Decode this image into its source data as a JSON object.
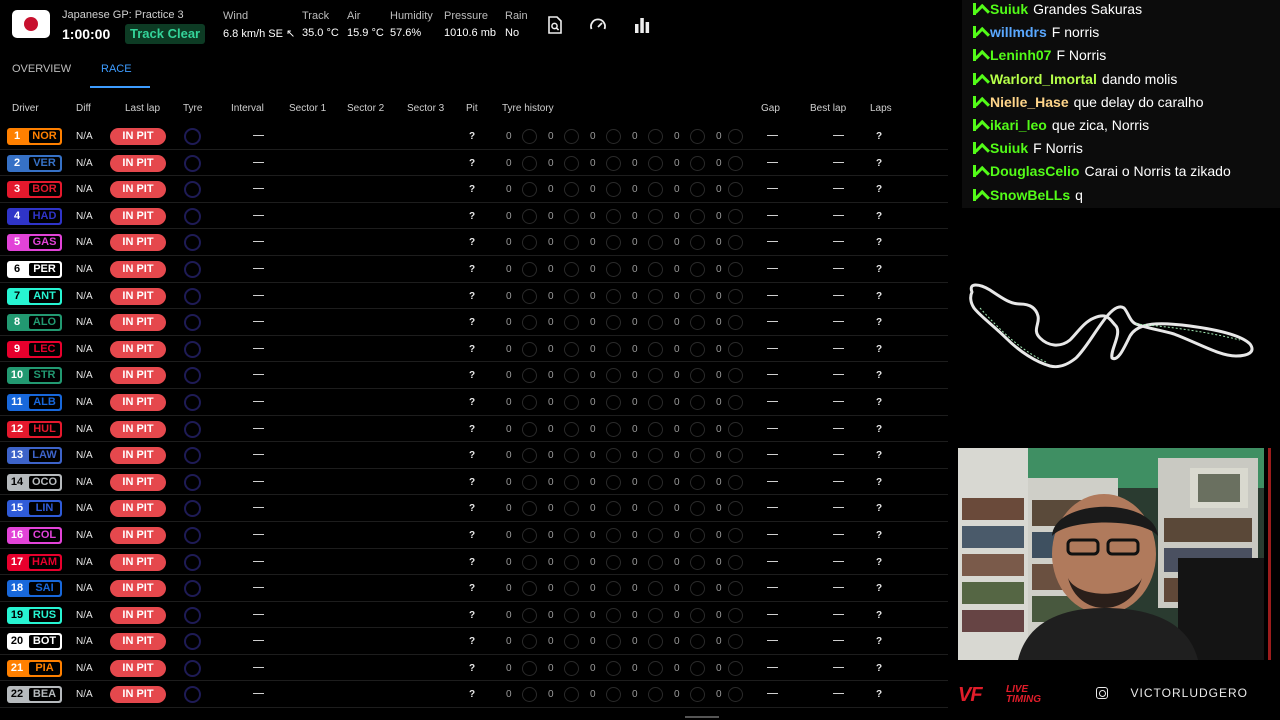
{
  "header": {
    "session_name": "Japanese GP: Practice 3",
    "session_clock": "1:00:00",
    "track_status": "Track Clear",
    "weather": [
      {
        "label": "Wind",
        "value": "6.8 km/h SE ↖"
      },
      {
        "label": "Track",
        "value": "35.0 °C"
      },
      {
        "label": "Air",
        "value": "15.9 °C"
      },
      {
        "label": "Humidity",
        "value": "57.6%"
      },
      {
        "label": "Pressure",
        "value": "1010.6 mb"
      },
      {
        "label": "Rain",
        "value": "No"
      }
    ],
    "icons": [
      "document-search-icon",
      "speedometer-icon",
      "bar-chart-icon"
    ],
    "flag": "japan-flag"
  },
  "tabs": [
    {
      "label": "OVERVIEW",
      "active": false
    },
    {
      "label": "RACE",
      "active": true
    }
  ],
  "columns": [
    "Driver",
    "Diff",
    "Last lap",
    "Tyre",
    "Interval",
    "Sector 1",
    "Sector 2",
    "Sector 3",
    "Pit",
    "Tyre history",
    "Gap",
    "Best lap",
    "Laps"
  ],
  "row_defaults": {
    "diff": "N/A",
    "status": "IN PIT",
    "dash": "—",
    "pit": "?",
    "history_zero": "0",
    "laps": "?"
  },
  "drivers": [
    {
      "pos": "1",
      "code": "NOR",
      "color": "#ff8000"
    },
    {
      "pos": "2",
      "code": "VER",
      "color": "#3671c6"
    },
    {
      "pos": "3",
      "code": "BOR",
      "color": "#e4192d"
    },
    {
      "pos": "4",
      "code": "HAD",
      "color": "#2f34c8"
    },
    {
      "pos": "5",
      "code": "GAS",
      "color": "#e243d8"
    },
    {
      "pos": "6",
      "code": "PER",
      "color": "#ffffff"
    },
    {
      "pos": "7",
      "code": "ANT",
      "color": "#27f4d2"
    },
    {
      "pos": "8",
      "code": "ALO",
      "color": "#229971"
    },
    {
      "pos": "9",
      "code": "LEC",
      "color": "#e8002d"
    },
    {
      "pos": "10",
      "code": "STR",
      "color": "#229971"
    },
    {
      "pos": "11",
      "code": "ALB",
      "color": "#1868db"
    },
    {
      "pos": "12",
      "code": "HUL",
      "color": "#e4192d"
    },
    {
      "pos": "13",
      "code": "LAW",
      "color": "#3d63c9"
    },
    {
      "pos": "14",
      "code": "OCO",
      "color": "#b6babd"
    },
    {
      "pos": "15",
      "code": "LIN",
      "color": "#2f5bd8"
    },
    {
      "pos": "16",
      "code": "COL",
      "color": "#e243d8"
    },
    {
      "pos": "17",
      "code": "HAM",
      "color": "#e8002d"
    },
    {
      "pos": "18",
      "code": "SAI",
      "color": "#1868db"
    },
    {
      "pos": "19",
      "code": "RUS",
      "color": "#27f4d2"
    },
    {
      "pos": "20",
      "code": "BOT",
      "color": "#ffffff"
    },
    {
      "pos": "21",
      "code": "PIA",
      "color": "#ff8000"
    },
    {
      "pos": "22",
      "code": "BEA",
      "color": "#b6babd"
    }
  ],
  "chat": [
    {
      "user": "Suiuk",
      "user_color": "#53fc18",
      "message": "Grandes Sakuras"
    },
    {
      "user": "willmdrs",
      "user_color": "#5aa8ff",
      "message": "F norris"
    },
    {
      "user": "Leninh07",
      "user_color": "#53fc18",
      "message": "F Norris"
    },
    {
      "user": "Warlord_Imortal",
      "user_color": "#b6ff4a",
      "message": "dando molis"
    },
    {
      "user": "Nielle_Hase",
      "user_color": "#ffd58a",
      "message": "que delay do caralho"
    },
    {
      "user": "ikari_leo",
      "user_color": "#53fc18",
      "message": "que zica, Norris"
    },
    {
      "user": "Suiuk",
      "user_color": "#53fc18",
      "message": "F Norris"
    },
    {
      "user": "DouglasCelio",
      "user_color": "#53fc18",
      "message": "Carai o Norris ta zikado"
    },
    {
      "user": "SnowBeLLs",
      "user_color": "#53fc18",
      "message": "q"
    }
  ],
  "brand": {
    "logo": "VF",
    "logo_sub_1": "LIVE",
    "logo_sub_2": "TIMING",
    "handle": "VICTORLUDGERO",
    "social_icon": "instagram-icon"
  }
}
